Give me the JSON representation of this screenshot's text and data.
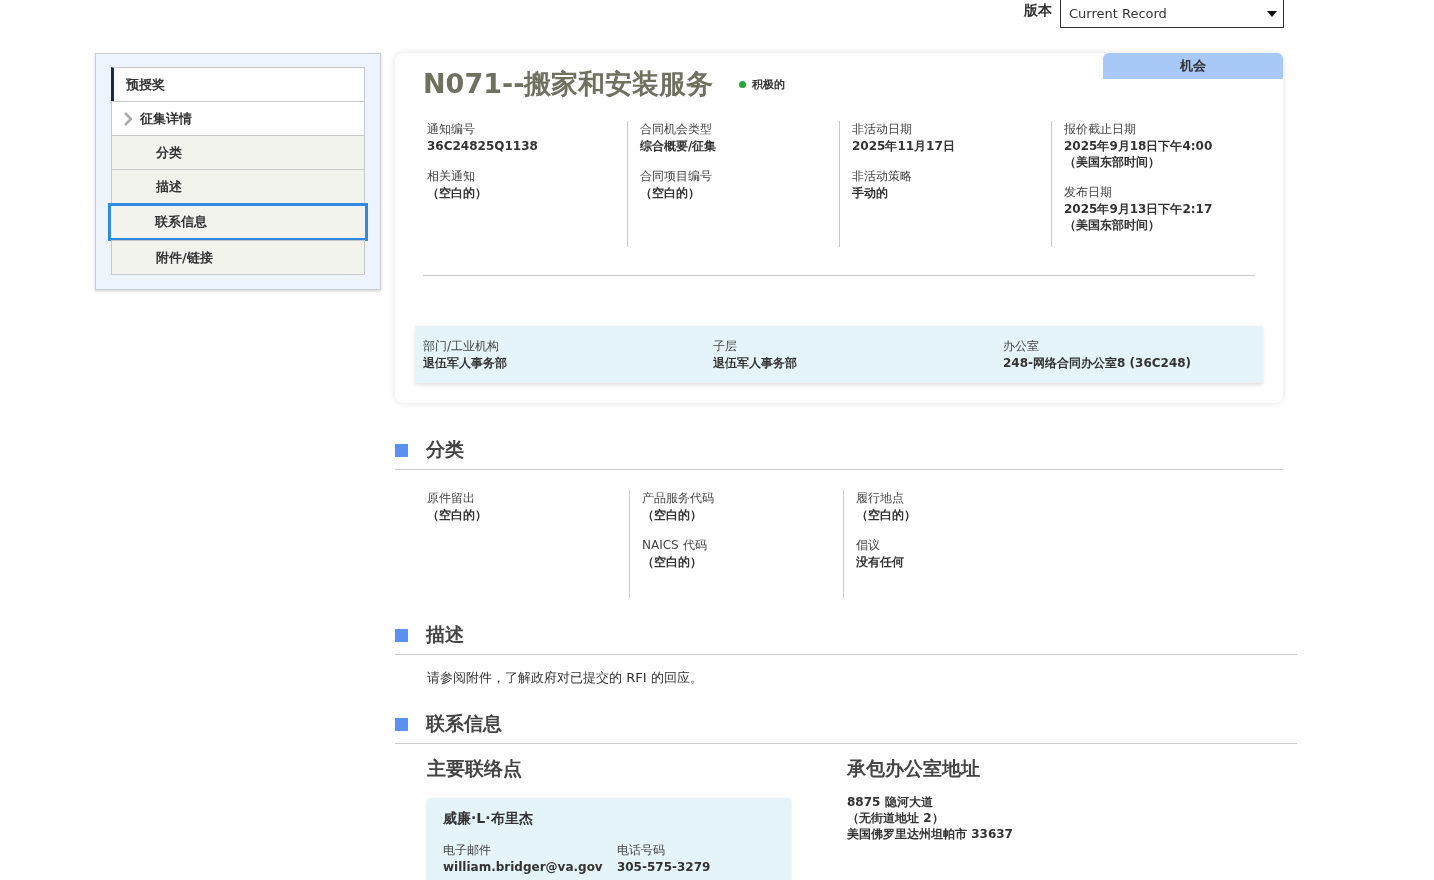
{
  "version": {
    "label": "版本",
    "value": "Current Record"
  },
  "nav": [
    {
      "label": "预授奖",
      "kind": "top",
      "current": true,
      "selected": false
    },
    {
      "label": "征集详情",
      "kind": "parent",
      "current": false,
      "selected": false
    },
    {
      "label": "分类",
      "kind": "sub",
      "current": false,
      "selected": false
    },
    {
      "label": "描述",
      "kind": "sub",
      "current": false,
      "selected": false
    },
    {
      "label": "联系信息",
      "kind": "sub",
      "current": false,
      "selected": true
    },
    {
      "label": "附件/链接",
      "kind": "sub",
      "current": false,
      "selected": false
    }
  ],
  "header": {
    "title": "N071--搬家和安装服务",
    "status": {
      "label": "积极的",
      "color": "#22a83a"
    },
    "tag": "机会",
    "columns": [
      [
        {
          "label": "通知编号",
          "value": "36C24825Q1138"
        },
        {
          "label": "相关通知",
          "value": "（空白的）"
        }
      ],
      [
        {
          "label": "合同机会类型",
          "value": "综合概要/征集"
        },
        {
          "label": "合同项目编号",
          "value": "（空白的）"
        }
      ],
      [
        {
          "label": "非活动日期",
          "value": "2025年11月17日"
        },
        {
          "label": "非活动策略",
          "value": "手动的"
        }
      ],
      [
        {
          "label": "报价截止日期",
          "value": "2025年9月18日下午4:00\n（美国东部时间）"
        },
        {
          "label": "发布日期",
          "value": "2025年9月13日下午2:17\n（美国东部时间）"
        }
      ]
    ],
    "agency": [
      {
        "label": "部门/工业机构",
        "value": "退伍军人事务部"
      },
      {
        "label": "子层",
        "value": "退伍军人事务部"
      },
      {
        "label": "办公室",
        "value": "248-网络合同办公室8 (36C248)"
      }
    ]
  },
  "classification": {
    "title": "分类",
    "columns": [
      [
        {
          "label": "原件留出",
          "value": "（空白的）"
        }
      ],
      [
        {
          "label": "产品服务代码",
          "value": "（空白的）"
        },
        {
          "label": "NAICS 代码",
          "value": "（空白的）"
        }
      ],
      [
        {
          "label": "履行地点",
          "value": "（空白的）"
        },
        {
          "label": "倡议",
          "value": "没有任何"
        }
      ]
    ]
  },
  "description": {
    "title": "描述",
    "text": "请参阅附件，了解政府对已提交的 RFI 的回应。"
  },
  "contact": {
    "title": "联系信息",
    "primary_title": "主要联络点",
    "name": "威廉·L·布里杰",
    "fields": [
      {
        "label": "电子邮件",
        "value": "william.bridger@va.gov"
      },
      {
        "label": "电话号码",
        "value": "305-575-3279"
      }
    ],
    "office_title": "承包办公室地址",
    "address": [
      "8875 隐河大道",
      "（无街道地址 2）",
      "美国佛罗里达州坦帕市 33637"
    ]
  }
}
